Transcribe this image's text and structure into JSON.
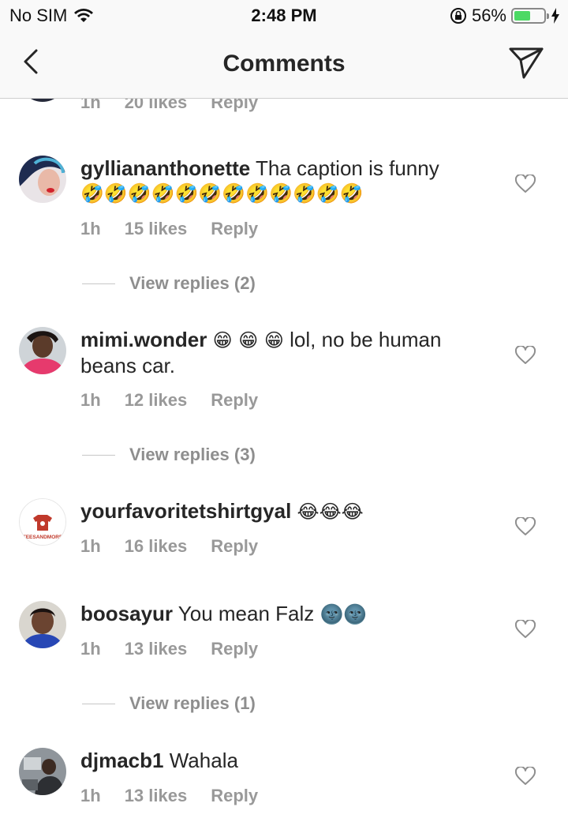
{
  "status_bar": {
    "carrier": "No SIM",
    "time": "2:48 PM",
    "battery_percent": "56%",
    "battery_level": 0.56
  },
  "nav": {
    "title": "Comments",
    "back_icon": "chevron-left-icon",
    "send_icon": "paper-plane-icon"
  },
  "top_partial": {
    "time": "1h",
    "likes": "20 likes",
    "reply": "Reply"
  },
  "comments": [
    {
      "username": "gylliananthonette",
      "text": "Tha caption is funny",
      "emoji": "🤣🤣🤣🤣🤣🤣🤣🤣🤣🤣🤣🤣",
      "time": "1h",
      "likes": "15 likes",
      "reply": "Reply",
      "view_replies": "View replies (2)"
    },
    {
      "username": "mimi.wonder",
      "text_pre_emoji": "😁 😁 😁",
      "text": "lol,  no be human beans car.",
      "time": "1h",
      "likes": "12 likes",
      "reply": "Reply",
      "view_replies": "View replies (3)"
    },
    {
      "username": "yourfavoritetshirtgyal",
      "emoji": "😂😂😂",
      "time": "1h",
      "likes": "16 likes",
      "reply": "Reply",
      "avatar_text": "TEESANDMORE"
    },
    {
      "username": "boosayur",
      "text": "You mean Falz",
      "emoji": "🌚🌚",
      "time": "1h",
      "likes": "13 likes",
      "reply": "Reply",
      "view_replies": "View replies (1)"
    },
    {
      "username": "djmacb1",
      "text": "Wahala",
      "time": "1h",
      "likes": "13 likes",
      "reply": "Reply"
    }
  ]
}
